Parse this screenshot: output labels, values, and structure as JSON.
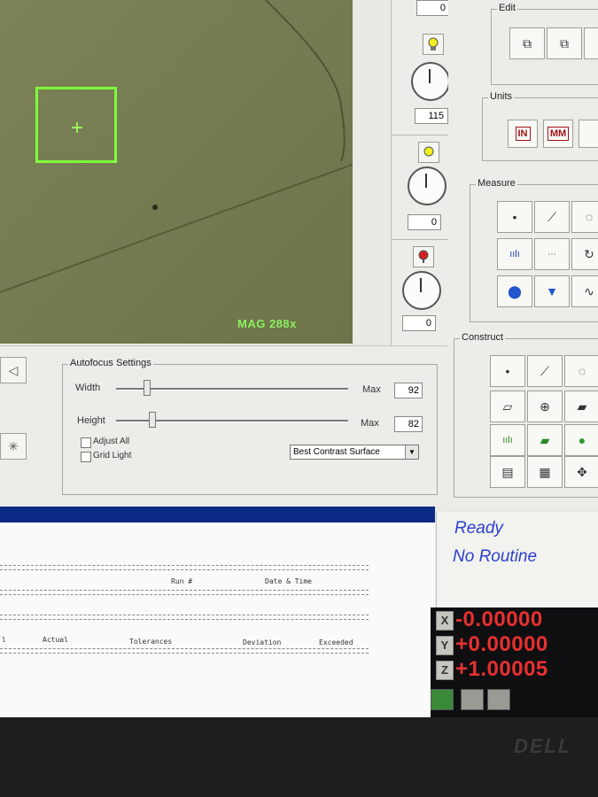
{
  "camera": {
    "magnification": "MAG 288x"
  },
  "tool_column": {
    "top_value": "0",
    "dial1_value": "115",
    "dial2_value": "0",
    "dial3_value": "0"
  },
  "panels": {
    "edit_label": "Edit",
    "units_label": "Units",
    "units_in": "IN",
    "units_mm": "MM",
    "measure_label": "Measure",
    "construct_label": "Construct"
  },
  "autofocus": {
    "title": "Autofocus Settings",
    "width_label": "Width",
    "width_max_label": "Max",
    "width_value": "92",
    "width_slider_level": 0.12,
    "height_label": "Height",
    "height_max_label": "Max",
    "height_value": "82",
    "height_slider_level": 0.14,
    "adjust_all_label": "Adjust All",
    "grid_light_label": "Grid Light",
    "surface_mode": "Best Contrast Surface"
  },
  "report": {
    "run_header": "Run #",
    "date_header": "Date & Time",
    "col_partial": "l",
    "col_actual": "Actual",
    "col_tolerances": "Tolerances",
    "col_deviation": "Deviation",
    "col_exceeded": "Exceeded"
  },
  "status": {
    "state": "Ready",
    "routine": "No Routine"
  },
  "dro": {
    "x_label": "X",
    "x_value": "-0.00000",
    "y_label": "Y",
    "y_value": "+0.00000",
    "z_label": "Z",
    "z_value": "+1.00005"
  },
  "monitor": {
    "brand": "DELL"
  },
  "colors": {
    "fov_box": "#7dff3a",
    "report_bar": "#0b2a86",
    "status_text": "#2a3fcc",
    "dro_value": "#e83030"
  }
}
